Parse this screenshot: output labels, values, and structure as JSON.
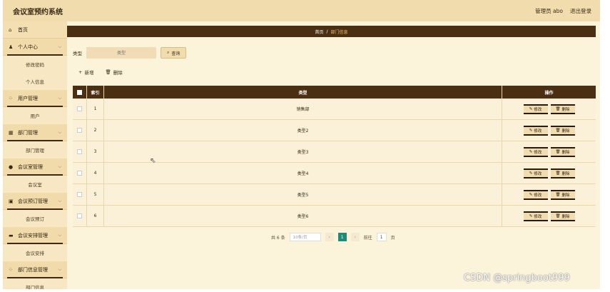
{
  "header": {
    "title": "会议室预约系统",
    "user_role": "管理员 abo",
    "logout": "退出登录"
  },
  "sidebar": {
    "home": "首页",
    "personal_center": "个人中心",
    "change_password": "修改密码",
    "personal_info": "个人信息",
    "user_mgmt": "用户管理",
    "user": "用户",
    "dept_mgmt": "部门管理",
    "dept_sub": "部门管理",
    "room_mgmt": "会议室管理",
    "room": "会议室",
    "booking_mgmt": "会议预订管理",
    "booking": "会议预订",
    "arrange_mgmt": "会议安排管理",
    "arrange": "会议安排",
    "dept_info_mgmt": "部门信息管理",
    "dept_info": "部门信息"
  },
  "breadcrumb": {
    "home": "首页",
    "sep": "/",
    "current": "部门信息"
  },
  "filter": {
    "label": "类型",
    "placeholder": "类型",
    "query_button": "查询"
  },
  "toolbar": {
    "add": "新增",
    "delete": "删除"
  },
  "table": {
    "headers": {
      "index": "索引",
      "type": "类型",
      "op": "操作"
    },
    "rows": [
      {
        "index": "1",
        "type": "销售部"
      },
      {
        "index": "2",
        "type": "类型2"
      },
      {
        "index": "3",
        "type": "类型3"
      },
      {
        "index": "4",
        "type": "类型4"
      },
      {
        "index": "5",
        "type": "类型5"
      },
      {
        "index": "6",
        "type": "类型6"
      }
    ],
    "edit_label": "修改",
    "delete_label": "删除"
  },
  "pager": {
    "total": "共 6 条",
    "page_size": "10条/页",
    "current_page": "1",
    "goto_label": "前往",
    "goto_value": "1",
    "page_suffix": "页"
  },
  "watermark": "CSDN @springboot999"
}
